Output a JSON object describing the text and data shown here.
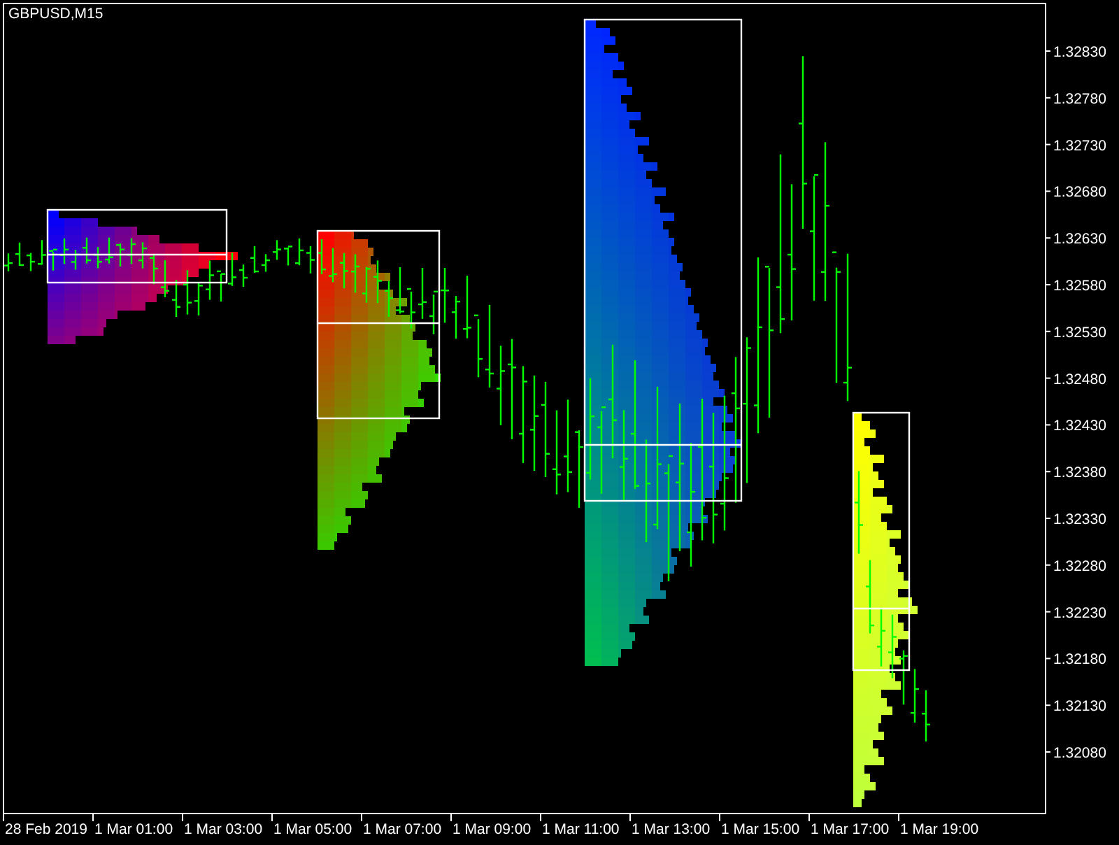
{
  "chart": {
    "title": "GBPUSD,M15",
    "price_axis": [
      "1.32830",
      "1.32780",
      "1.32730",
      "1.32680",
      "1.32630",
      "1.32580",
      "1.32530",
      "1.32480",
      "1.32430",
      "1.32380",
      "1.32330",
      "1.32280",
      "1.32230",
      "1.32180",
      "1.32130",
      "1.32080"
    ],
    "time_axis": [
      "28 Feb 2019",
      "1 Mar 01:00",
      "1 Mar 03:00",
      "1 Mar 05:00",
      "1 Mar 07:00",
      "1 Mar 09:00",
      "1 Mar 11:00",
      "1 Mar 13:00",
      "1 Mar 15:00",
      "1 Mar 17:00",
      "1 Mar 19:00"
    ]
  }
}
